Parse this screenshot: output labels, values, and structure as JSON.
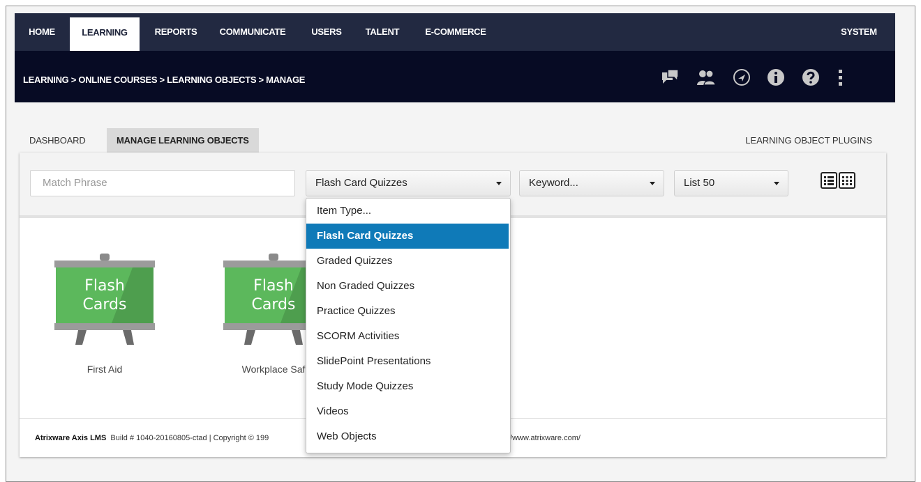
{
  "nav": {
    "items": [
      {
        "label": "HOME"
      },
      {
        "label": "LEARNING"
      },
      {
        "label": "REPORTS"
      },
      {
        "label": "COMMUNICATE"
      },
      {
        "label": "USERS"
      },
      {
        "label": "TALENT"
      },
      {
        "label": "E-COMMERCE"
      }
    ],
    "system": "SYSTEM"
  },
  "breadcrumb": "LEARNING > ONLINE COURSES > LEARNING OBJECTS > MANAGE",
  "header_icons": [
    "chat-icon",
    "users-icon",
    "navigation-icon",
    "info-icon",
    "help-icon",
    "more-vertical-icon"
  ],
  "tabs": {
    "dashboard": "DASHBOARD",
    "manage": "MANAGE LEARNING OBJECTS",
    "plugins": "LEARNING OBJECT PLUGINS"
  },
  "filters": {
    "search_placeholder": "Match Phrase",
    "item_type": "Flash Card Quizzes",
    "keyword": "Keyword...",
    "list": "List 50"
  },
  "dropdown": {
    "options": [
      "Item Type...",
      "Flash Card Quizzes",
      "Graded Quizzes",
      "Non Graded Quizzes",
      "Practice Quizzes",
      "SCORM Activities",
      "SlidePoint Presentations",
      "Study Mode Quizzes",
      "Videos",
      "Web Objects"
    ],
    "selected_index": 1
  },
  "cards": [
    {
      "board_line1": "Flash",
      "board_line2": "Cards",
      "title": "First Aid"
    },
    {
      "board_line1": "Flash",
      "board_line2": "Cards",
      "title": "Workplace Saf"
    }
  ],
  "footer": {
    "brand": "Atrixware Axis LMS",
    "build": "Build # 1040-20160805-ctad | Copyright © 199",
    "url_fragment": "//www.atrixware.com/"
  },
  "colors": {
    "nav_bg": "#222941",
    "subbar_bg": "#070b24",
    "accent": "#0f7ab8",
    "board_green": "#5cb85c"
  }
}
